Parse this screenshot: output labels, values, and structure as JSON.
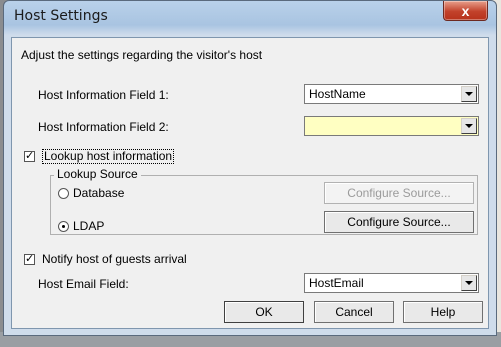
{
  "window": {
    "title": "Host Settings",
    "close_glyph": "x"
  },
  "description": "Adjust the settings regarding the visitor's host",
  "fields": {
    "field1_label": "Host Information Field 1:",
    "field1_value": "HostName",
    "field2_label": "Host Information Field 2:",
    "field2_value": ""
  },
  "lookup": {
    "checkbox_label": "Lookup host information",
    "checked_glyph": "✓",
    "group_title": "Lookup Source",
    "option_database": "Database",
    "option_ldap": "LDAP",
    "selected": "LDAP",
    "configure_label_1": "Configure Source...",
    "configure_label_2": "Configure Source..."
  },
  "notify": {
    "checkbox_label": "Notify host of guests arrival",
    "checked_glyph": "✓",
    "email_label": "Host Email Field:",
    "email_value": "HostEmail"
  },
  "buttons": {
    "ok": "OK",
    "cancel": "Cancel",
    "help": "Help"
  },
  "colors": {
    "highlight_field": "#ffffc2",
    "close_button": "#c2422b"
  }
}
